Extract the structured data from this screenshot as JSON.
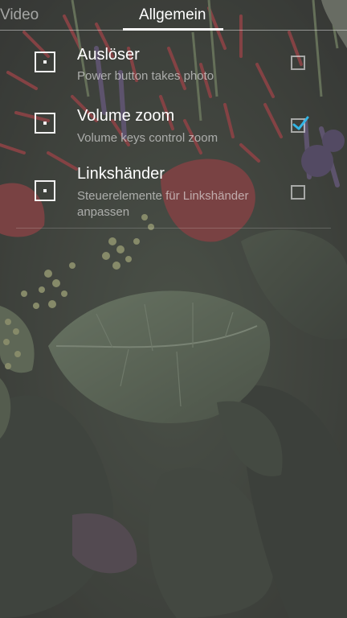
{
  "tabs": [
    {
      "label": "Video",
      "selected": false
    },
    {
      "label": "Allgemein",
      "selected": true
    }
  ],
  "settings": [
    {
      "title": "Auslöser",
      "summary": "Power button takes photo",
      "checked": false,
      "icon": "square-dot-icon"
    },
    {
      "title": "Volume zoom",
      "summary": "Volume keys control zoom",
      "checked": true,
      "icon": "square-dot-icon"
    },
    {
      "title": "Linkshänder",
      "summary": "Steuerelemente für Linkshänder anpassen",
      "checked": false,
      "icon": "square-dot-icon"
    }
  ],
  "colors": {
    "accent": "#33b5e5",
    "text_primary": "#ffffff",
    "overlay": "#5f5f5f"
  }
}
